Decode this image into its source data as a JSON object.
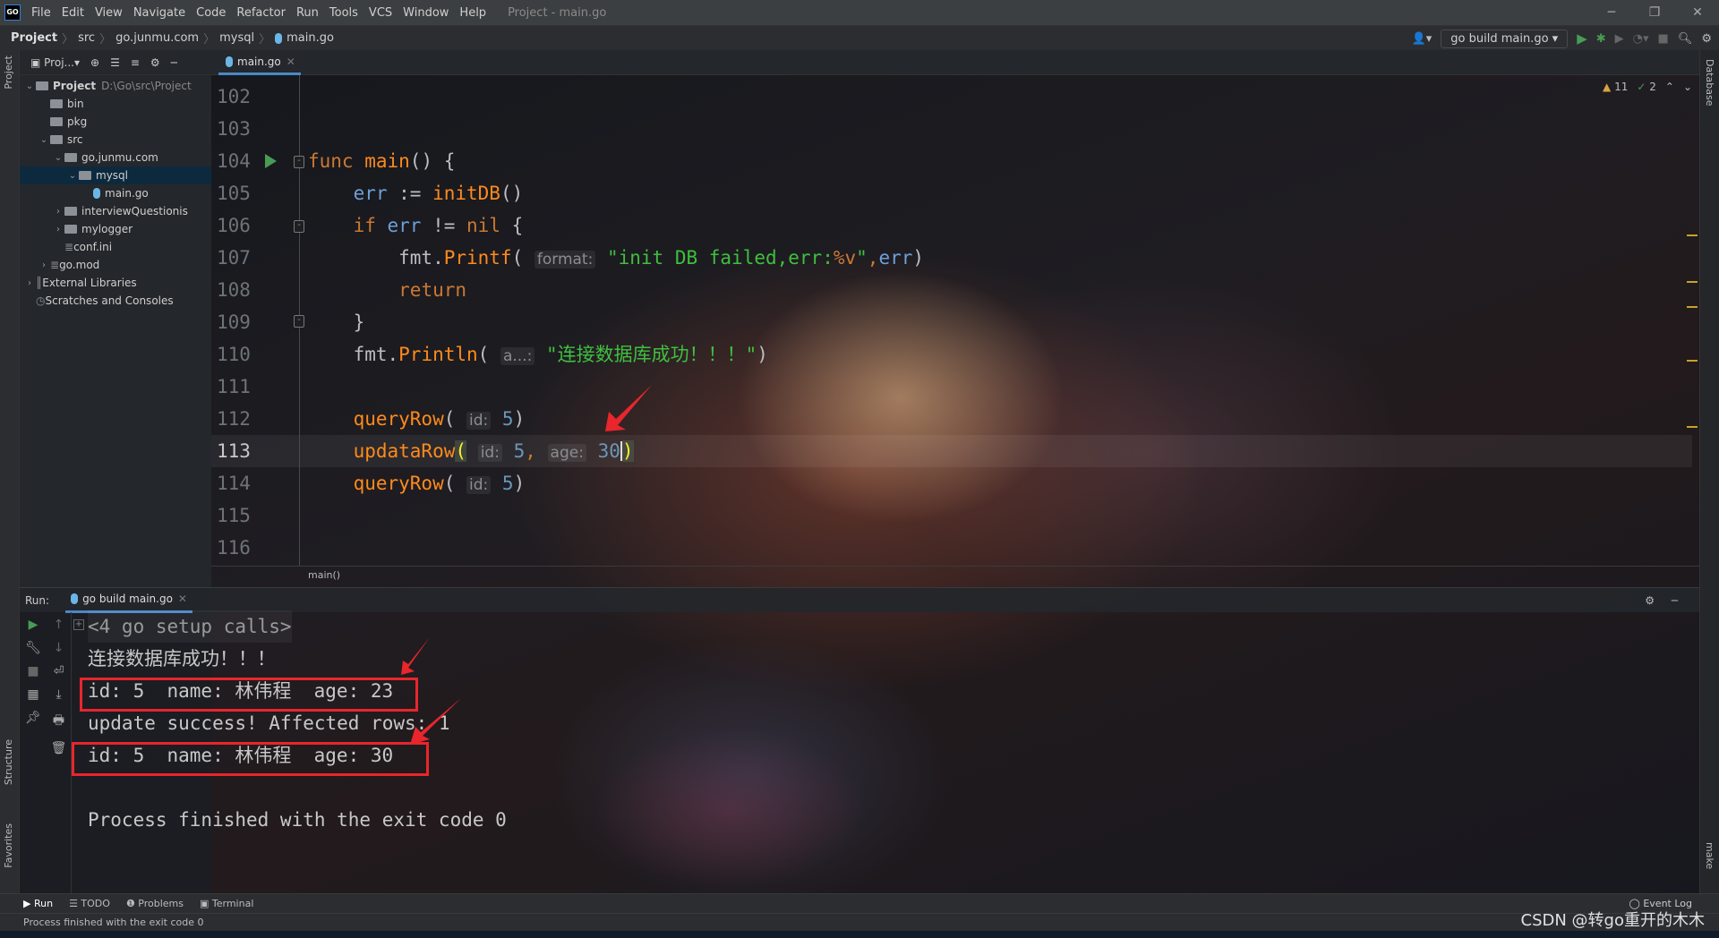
{
  "window": {
    "title": "Project - main.go",
    "menu": [
      "File",
      "Edit",
      "View",
      "Navigate",
      "Code",
      "Refactor",
      "Run",
      "Tools",
      "VCS",
      "Window",
      "Help"
    ],
    "logo": "GO"
  },
  "breadcrumb": [
    "Project",
    "src",
    "go.junmu.com",
    "mysql",
    "main.go"
  ],
  "run_config": "go build main.go",
  "project_panel": {
    "dropdown": "Proj...",
    "tree": [
      {
        "label": "Project",
        "hint": "D:\\Go\\src\\Project",
        "depth": 0,
        "arrow": "down",
        "icon": "folder",
        "bold": true
      },
      {
        "label": "bin",
        "depth": 1,
        "icon": "folder"
      },
      {
        "label": "pkg",
        "depth": 1,
        "icon": "folder"
      },
      {
        "label": "src",
        "depth": 1,
        "arrow": "down",
        "icon": "folder"
      },
      {
        "label": "go.junmu.com",
        "depth": 2,
        "arrow": "down",
        "icon": "folder"
      },
      {
        "label": "mysql",
        "depth": 3,
        "arrow": "down",
        "icon": "folder",
        "selected": true
      },
      {
        "label": "main.go",
        "depth": 4,
        "icon": "go-file"
      },
      {
        "label": "interviewQuestionis",
        "depth": 2,
        "arrow": "right",
        "icon": "folder"
      },
      {
        "label": "mylogger",
        "depth": 2,
        "arrow": "right",
        "icon": "folder"
      },
      {
        "label": "conf.ini",
        "depth": 2,
        "icon": "ini-file"
      },
      {
        "label": "go.mod",
        "depth": 1,
        "arrow": "right",
        "icon": "mod-file"
      },
      {
        "label": "External Libraries",
        "depth": 0,
        "arrow": "right",
        "icon": "library"
      },
      {
        "label": "Scratches and Consoles",
        "depth": 0,
        "icon": "scratch"
      }
    ]
  },
  "editor": {
    "tab": "main.go",
    "warnings": "11",
    "weak_warnings": "2",
    "current_line": 113,
    "line_numbers": [
      102,
      103,
      104,
      105,
      106,
      107,
      108,
      109,
      110,
      111,
      112,
      113,
      114,
      115,
      116
    ],
    "lines": [
      [],
      [],
      [
        [
          "kw",
          "func "
        ],
        [
          "fn",
          "main"
        ],
        [
          "pl",
          "() {"
        ]
      ],
      [
        [
          "pl",
          "    "
        ],
        [
          "id",
          "err"
        ],
        [
          "pl",
          " := "
        ],
        [
          "fn",
          "initDB"
        ],
        [
          "pl",
          "()"
        ]
      ],
      [
        [
          "pl",
          "    "
        ],
        [
          "kw",
          "if "
        ],
        [
          "id",
          "err"
        ],
        [
          "pl",
          " != "
        ],
        [
          "kw",
          "nil"
        ],
        [
          "pl",
          " {"
        ]
      ],
      [
        [
          "pl",
          "        fmt."
        ],
        [
          "fn",
          "Printf"
        ],
        [
          "pl",
          "( "
        ],
        [
          "ph",
          "format:"
        ],
        [
          "str",
          " \"init DB failed,err:"
        ],
        [
          "kw",
          "%v"
        ],
        [
          "str",
          "\""
        ],
        [
          "kw",
          ","
        ],
        [
          "id",
          "err"
        ],
        [
          "pl",
          ")"
        ]
      ],
      [
        [
          "pl",
          "        "
        ],
        [
          "ret",
          "return"
        ]
      ],
      [
        [
          "pl",
          "    }"
        ]
      ],
      [
        [
          "pl",
          "    fmt."
        ],
        [
          "fn",
          "Println"
        ],
        [
          "pl",
          "( "
        ],
        [
          "ph",
          "a...:"
        ],
        [
          "str",
          " \"连接数据库成功！！！\""
        ],
        [
          "pl",
          ")"
        ]
      ],
      [],
      [
        [
          "pl",
          "    "
        ],
        [
          "fn",
          "queryRow"
        ],
        [
          "pl",
          "( "
        ],
        [
          "ph",
          "id:"
        ],
        [
          "num",
          " 5"
        ],
        [
          "pl",
          ")"
        ]
      ],
      [
        [
          "pl",
          "    "
        ],
        [
          "fn",
          "updataRow"
        ],
        [
          "bm",
          "("
        ],
        [
          "pl",
          " "
        ],
        [
          "ph",
          "id:"
        ],
        [
          "num",
          " 5"
        ],
        [
          "kw",
          ", "
        ],
        [
          "ph",
          "age:"
        ],
        [
          "num",
          " 30"
        ],
        [
          "caret",
          ""
        ],
        [
          "bm",
          ")"
        ]
      ],
      [
        [
          "pl",
          "    "
        ],
        [
          "fn",
          "queryRow"
        ],
        [
          "pl",
          "( "
        ],
        [
          "ph",
          "id:"
        ],
        [
          "num",
          " 5"
        ],
        [
          "pl",
          ")"
        ]
      ],
      [],
      []
    ],
    "breadcrumb": "main()"
  },
  "run_panel": {
    "label": "Run:",
    "tab": "go build main.go",
    "output": [
      "<4 go setup calls>",
      "连接数据库成功！！！",
      "id: 5  name: 林伟程  age: 23",
      "update success! Affected rows: 1",
      "id: 5  name: 林伟程  age: 30",
      "",
      "Process finished with the exit code 0"
    ]
  },
  "side_labels": {
    "project": "Project",
    "structure": "Structure",
    "favorites": "Favorites",
    "database": "Database",
    "make": "make"
  },
  "bottom_tabs": [
    "Run",
    "TODO",
    "Problems",
    "Terminal"
  ],
  "event_log": "Event Log",
  "status": "Process finished with the exit code 0",
  "watermark": "CSDN @转go重开的木木",
  "colors": {
    "annotation": "#e8262c",
    "accent": "#4a88c7",
    "run_green": "#499c54"
  }
}
